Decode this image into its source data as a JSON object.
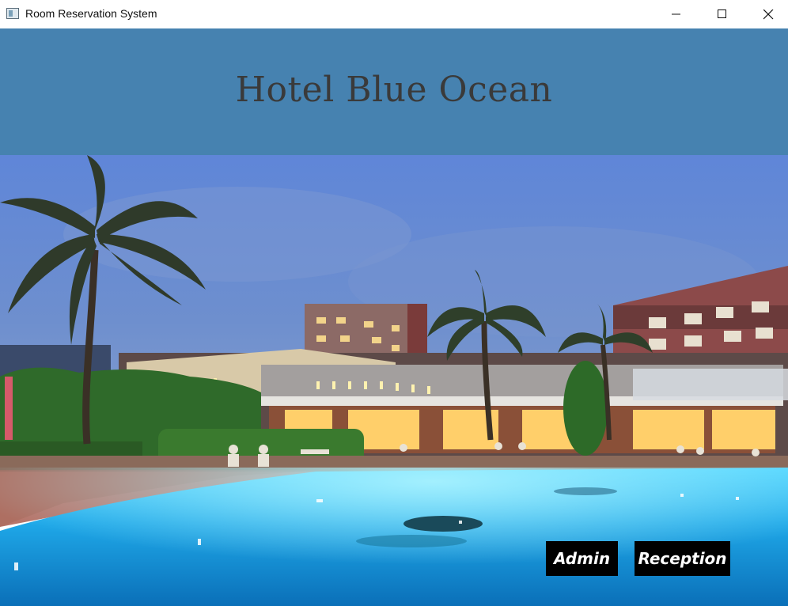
{
  "window": {
    "title": "Room Reservation System",
    "icon": "app-window-icon",
    "controls": [
      "minimize-icon",
      "maximize-icon",
      "close-icon"
    ]
  },
  "header": {
    "hotel_name": "Hotel Blue Ocean",
    "background_color": "#4682b0",
    "text_color": "#3a3a3a"
  },
  "photo": {
    "subject": "hotel-pool-at-dusk"
  },
  "buttons": {
    "admin_label": "Admin",
    "reception_label": "Reception",
    "background_color": "#000000",
    "text_color": "#ffffff"
  }
}
